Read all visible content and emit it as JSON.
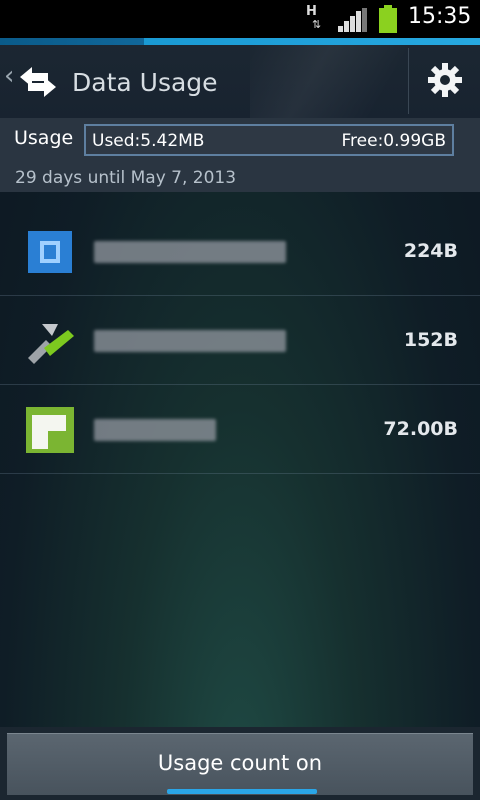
{
  "status_bar": {
    "network_type": "H",
    "network_arrows": "⇅",
    "time": "15:35",
    "battery_color": "#8bd11f"
  },
  "header": {
    "title": "Data Usage",
    "accent_color": "#27a8e0",
    "up_chevron": "‹",
    "app_icon": "data-transfer-arrows-icon",
    "settings_icon": "gear-icon"
  },
  "usage": {
    "label": "Usage",
    "used": "Used:5.42MB",
    "free": "Free:0.99GB",
    "cycle": "29 days until May 7, 2013"
  },
  "apps": [
    {
      "icon": "blue-app-icon",
      "size": "224B"
    },
    {
      "icon": "software-update-icon",
      "size": "152B"
    },
    {
      "icon": "green-app-icon",
      "size": "72.00B"
    }
  ],
  "footer": {
    "toggle_label": "Usage count on",
    "indicator_color": "#2aa6e8"
  }
}
